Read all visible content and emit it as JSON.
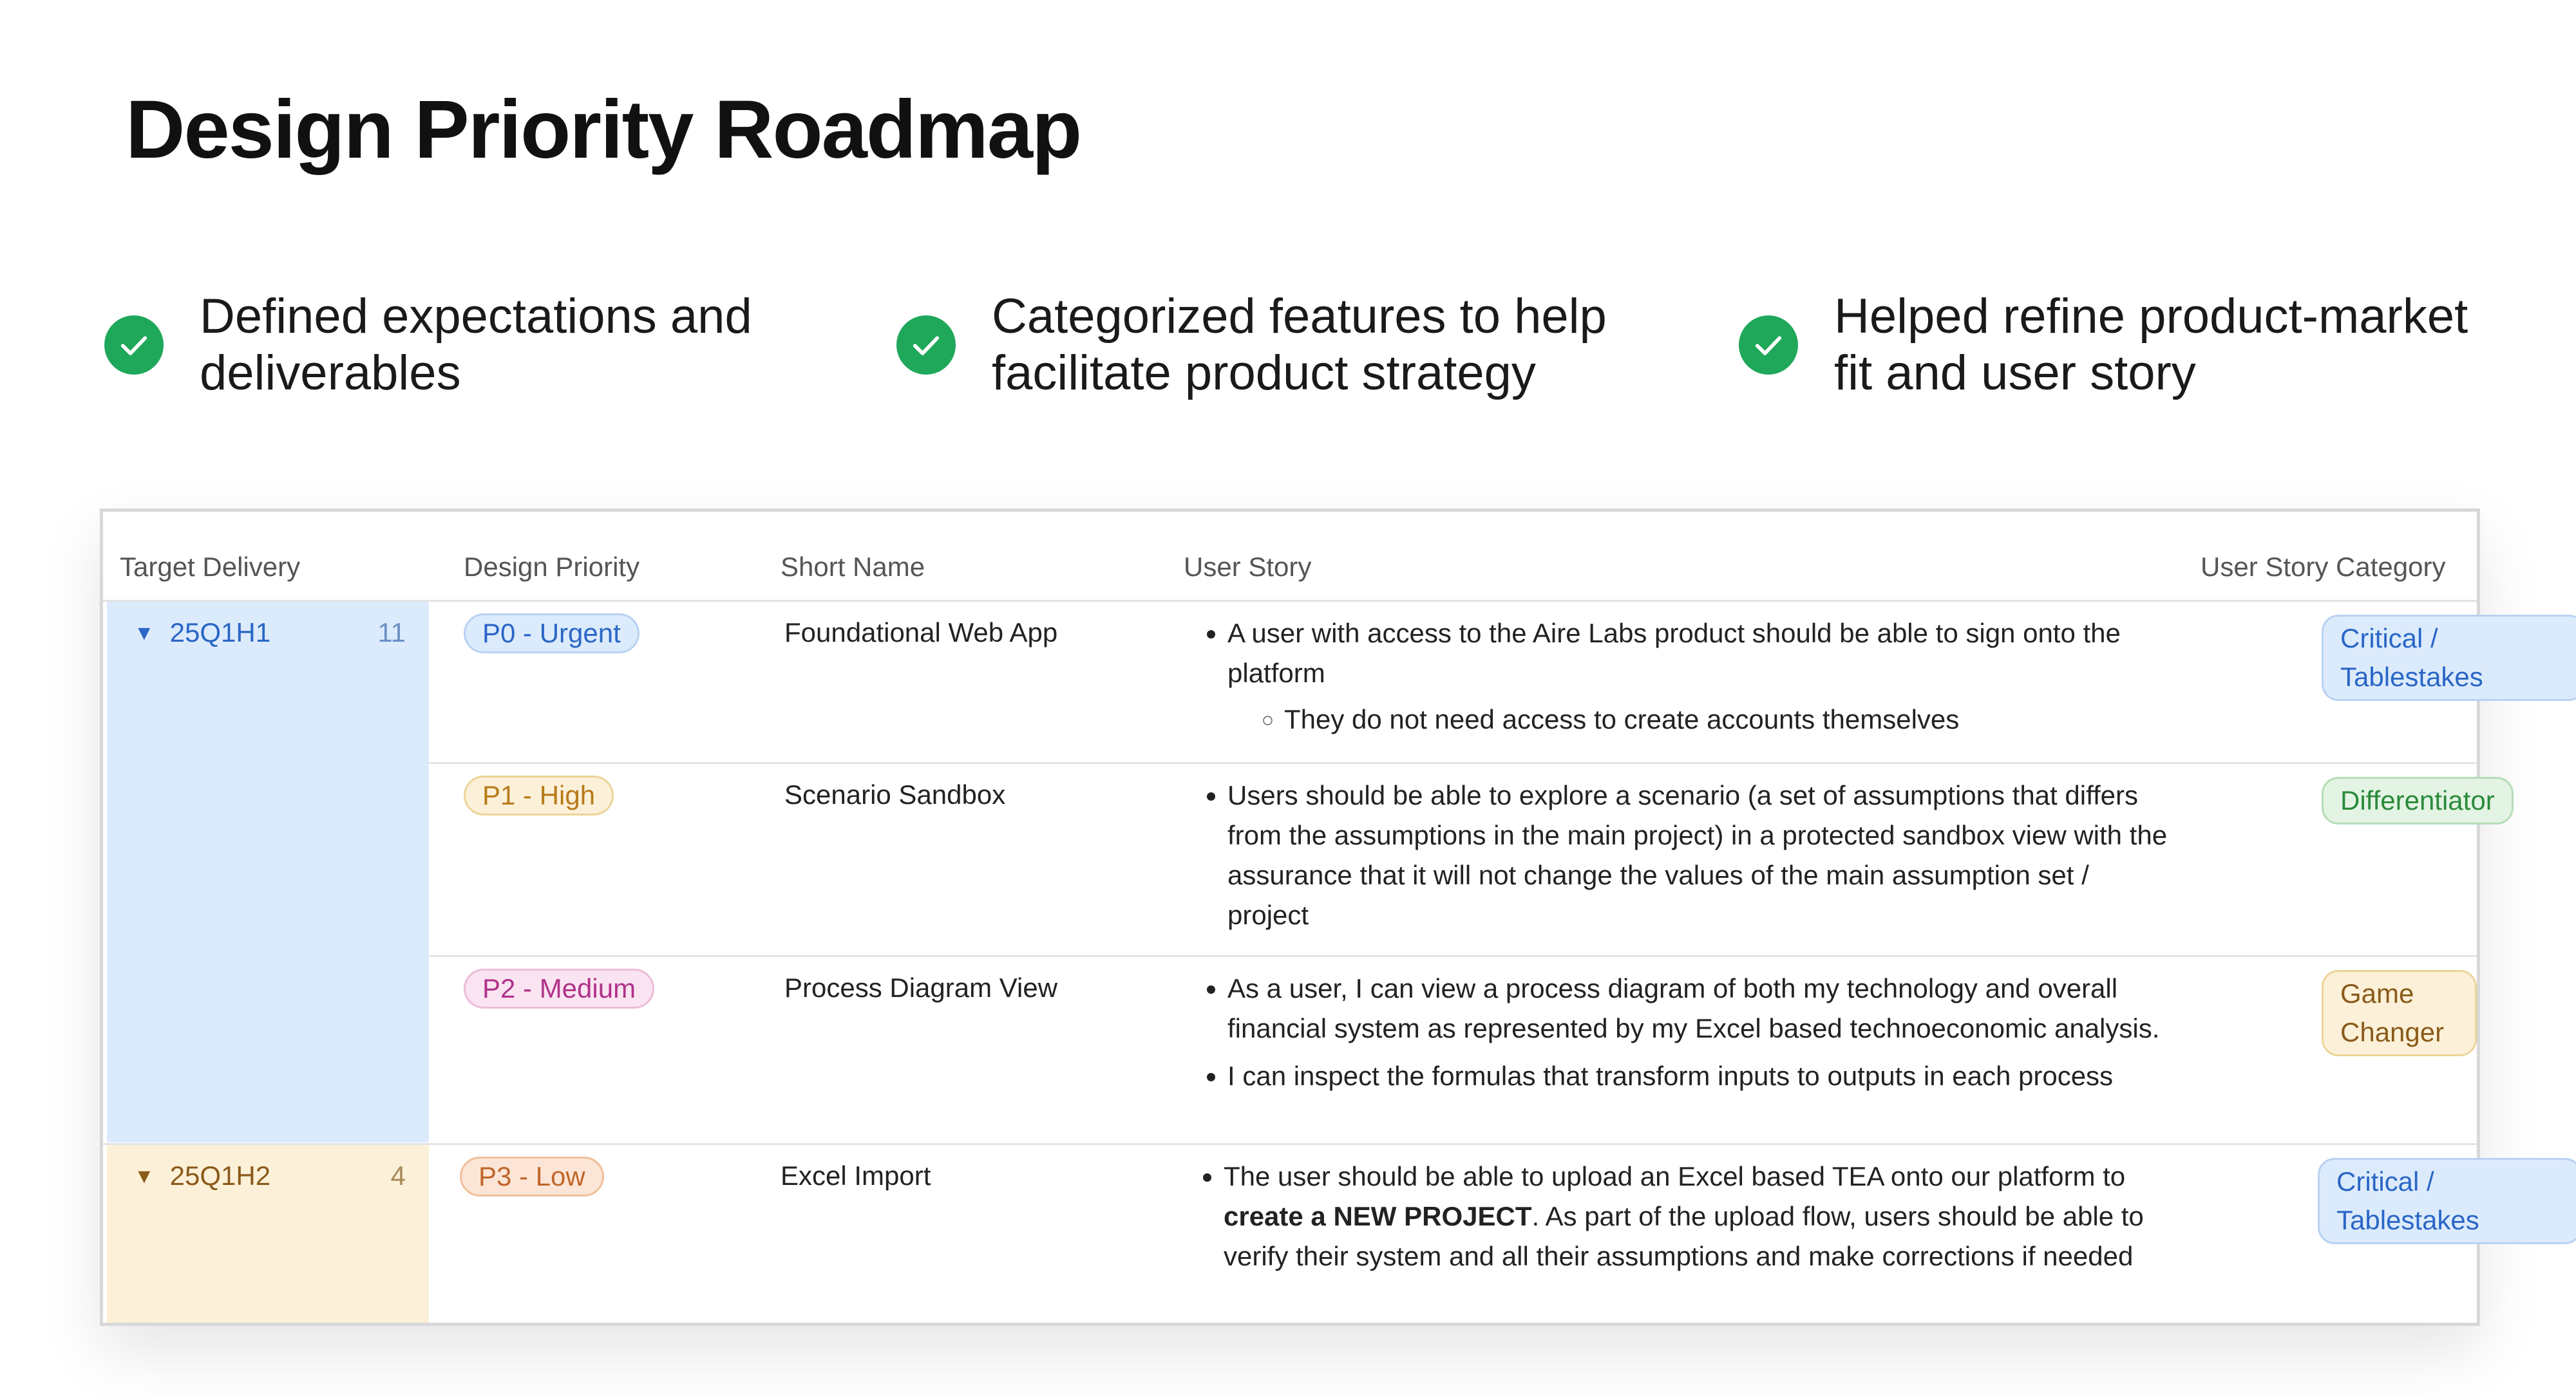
{
  "title": "Design Priority Roadmap",
  "highlights": [
    {
      "line1": "Defined expectations and",
      "line2": "deliverables",
      "icon": "check-circle-icon"
    },
    {
      "line1": "Categorized features to help",
      "line2": "facilitate product strategy",
      "icon": "check-circle-icon"
    },
    {
      "line1": "Helped refine product-market",
      "line2": "fit and user story",
      "icon": "check-circle-icon"
    }
  ],
  "colors": {
    "check": "#1fa85a",
    "group_h1_bg": "#dcebfc",
    "group_h2_bg": "#fcf1d8",
    "urgent": "#2a66c6",
    "high": "#b87a1a",
    "medium": "#b0328a",
    "low": "#c0662a"
  },
  "table": {
    "headers": {
      "target_delivery": "Target Delivery",
      "design_priority": "Design Priority",
      "short_name": "Short Name",
      "user_story": "User Story",
      "category": "User Story Category"
    },
    "groups": [
      {
        "label": "25Q1H1",
        "count": "11",
        "icon": "triangle-down-icon"
      },
      {
        "label": "25Q1H2",
        "count": "4",
        "icon": "triangle-down-icon"
      }
    ],
    "rows": [
      {
        "priority": "P0 - Urgent",
        "short_name": "Foundational Web App",
        "story_1": "A user with access to the Aire Labs product should be able to sign onto the platform",
        "story_sub": "They do not need access to create accounts themselves",
        "category_line1": "Critical /",
        "category_line2": "Tablestakes"
      },
      {
        "priority": "P1 - High",
        "short_name": "Scenario Sandbox",
        "story_1": "Users should be able to explore a scenario (a set of assumptions that differs from the assumptions in the main project) in a protected sandbox view with the assurance that it will not change the values of the main assumption set / project",
        "category": "Differentiator"
      },
      {
        "priority": "P2 - Medium",
        "short_name": "Process Diagram View",
        "story_1": "As a user, I can view a process diagram of both my technology and overall financial system as represented by my Excel based technoeconomic analysis.",
        "story_2": "I can inspect the formulas that transform inputs to outputs in each process",
        "category": "Game Changer"
      },
      {
        "priority": "P3 - Low",
        "short_name": "Excel Import",
        "story_pre": "The user should be able to upload an Excel based TEA onto our platform to ",
        "story_bold": "create a NEW PROJECT",
        "story_post": ".  As part of the upload flow, users should be able to verify their system and all their assumptions and make corrections if needed",
        "category_line1": "Critical /",
        "category_line2": "Tablestakes"
      }
    ]
  }
}
